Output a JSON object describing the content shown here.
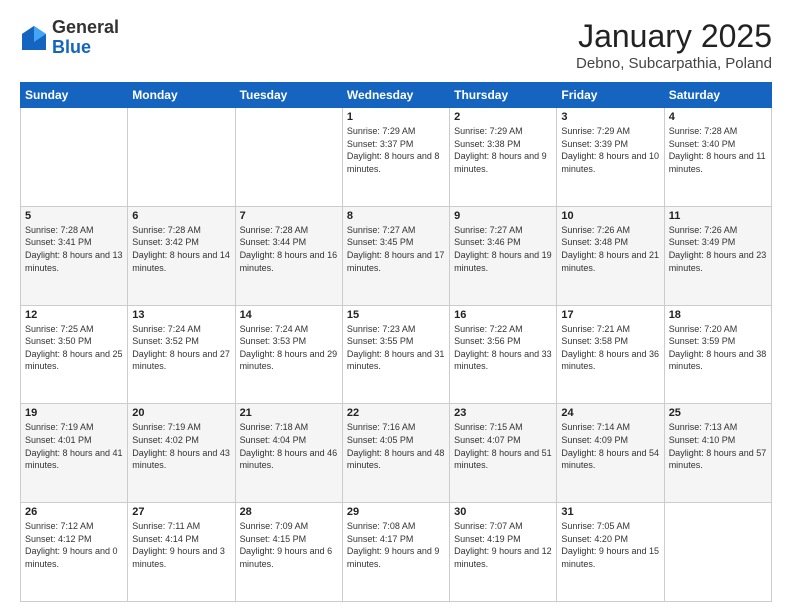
{
  "header": {
    "logo_general": "General",
    "logo_blue": "Blue",
    "main_title": "January 2025",
    "sub_title": "Debno, Subcarpathia, Poland"
  },
  "days_of_week": [
    "Sunday",
    "Monday",
    "Tuesday",
    "Wednesday",
    "Thursday",
    "Friday",
    "Saturday"
  ],
  "weeks": [
    [
      {
        "day": "",
        "info": ""
      },
      {
        "day": "",
        "info": ""
      },
      {
        "day": "",
        "info": ""
      },
      {
        "day": "1",
        "info": "Sunrise: 7:29 AM\nSunset: 3:37 PM\nDaylight: 8 hours\nand 8 minutes."
      },
      {
        "day": "2",
        "info": "Sunrise: 7:29 AM\nSunset: 3:38 PM\nDaylight: 8 hours\nand 9 minutes."
      },
      {
        "day": "3",
        "info": "Sunrise: 7:29 AM\nSunset: 3:39 PM\nDaylight: 8 hours\nand 10 minutes."
      },
      {
        "day": "4",
        "info": "Sunrise: 7:28 AM\nSunset: 3:40 PM\nDaylight: 8 hours\nand 11 minutes."
      }
    ],
    [
      {
        "day": "5",
        "info": "Sunrise: 7:28 AM\nSunset: 3:41 PM\nDaylight: 8 hours\nand 13 minutes."
      },
      {
        "day": "6",
        "info": "Sunrise: 7:28 AM\nSunset: 3:42 PM\nDaylight: 8 hours\nand 14 minutes."
      },
      {
        "day": "7",
        "info": "Sunrise: 7:28 AM\nSunset: 3:44 PM\nDaylight: 8 hours\nand 16 minutes."
      },
      {
        "day": "8",
        "info": "Sunrise: 7:27 AM\nSunset: 3:45 PM\nDaylight: 8 hours\nand 17 minutes."
      },
      {
        "day": "9",
        "info": "Sunrise: 7:27 AM\nSunset: 3:46 PM\nDaylight: 8 hours\nand 19 minutes."
      },
      {
        "day": "10",
        "info": "Sunrise: 7:26 AM\nSunset: 3:48 PM\nDaylight: 8 hours\nand 21 minutes."
      },
      {
        "day": "11",
        "info": "Sunrise: 7:26 AM\nSunset: 3:49 PM\nDaylight: 8 hours\nand 23 minutes."
      }
    ],
    [
      {
        "day": "12",
        "info": "Sunrise: 7:25 AM\nSunset: 3:50 PM\nDaylight: 8 hours\nand 25 minutes."
      },
      {
        "day": "13",
        "info": "Sunrise: 7:24 AM\nSunset: 3:52 PM\nDaylight: 8 hours\nand 27 minutes."
      },
      {
        "day": "14",
        "info": "Sunrise: 7:24 AM\nSunset: 3:53 PM\nDaylight: 8 hours\nand 29 minutes."
      },
      {
        "day": "15",
        "info": "Sunrise: 7:23 AM\nSunset: 3:55 PM\nDaylight: 8 hours\nand 31 minutes."
      },
      {
        "day": "16",
        "info": "Sunrise: 7:22 AM\nSunset: 3:56 PM\nDaylight: 8 hours\nand 33 minutes."
      },
      {
        "day": "17",
        "info": "Sunrise: 7:21 AM\nSunset: 3:58 PM\nDaylight: 8 hours\nand 36 minutes."
      },
      {
        "day": "18",
        "info": "Sunrise: 7:20 AM\nSunset: 3:59 PM\nDaylight: 8 hours\nand 38 minutes."
      }
    ],
    [
      {
        "day": "19",
        "info": "Sunrise: 7:19 AM\nSunset: 4:01 PM\nDaylight: 8 hours\nand 41 minutes."
      },
      {
        "day": "20",
        "info": "Sunrise: 7:19 AM\nSunset: 4:02 PM\nDaylight: 8 hours\nand 43 minutes."
      },
      {
        "day": "21",
        "info": "Sunrise: 7:18 AM\nSunset: 4:04 PM\nDaylight: 8 hours\nand 46 minutes."
      },
      {
        "day": "22",
        "info": "Sunrise: 7:16 AM\nSunset: 4:05 PM\nDaylight: 8 hours\nand 48 minutes."
      },
      {
        "day": "23",
        "info": "Sunrise: 7:15 AM\nSunset: 4:07 PM\nDaylight: 8 hours\nand 51 minutes."
      },
      {
        "day": "24",
        "info": "Sunrise: 7:14 AM\nSunset: 4:09 PM\nDaylight: 8 hours\nand 54 minutes."
      },
      {
        "day": "25",
        "info": "Sunrise: 7:13 AM\nSunset: 4:10 PM\nDaylight: 8 hours\nand 57 minutes."
      }
    ],
    [
      {
        "day": "26",
        "info": "Sunrise: 7:12 AM\nSunset: 4:12 PM\nDaylight: 9 hours\nand 0 minutes."
      },
      {
        "day": "27",
        "info": "Sunrise: 7:11 AM\nSunset: 4:14 PM\nDaylight: 9 hours\nand 3 minutes."
      },
      {
        "day": "28",
        "info": "Sunrise: 7:09 AM\nSunset: 4:15 PM\nDaylight: 9 hours\nand 6 minutes."
      },
      {
        "day": "29",
        "info": "Sunrise: 7:08 AM\nSunset: 4:17 PM\nDaylight: 9 hours\nand 9 minutes."
      },
      {
        "day": "30",
        "info": "Sunrise: 7:07 AM\nSunset: 4:19 PM\nDaylight: 9 hours\nand 12 minutes."
      },
      {
        "day": "31",
        "info": "Sunrise: 7:05 AM\nSunset: 4:20 PM\nDaylight: 9 hours\nand 15 minutes."
      },
      {
        "day": "",
        "info": ""
      }
    ]
  ]
}
